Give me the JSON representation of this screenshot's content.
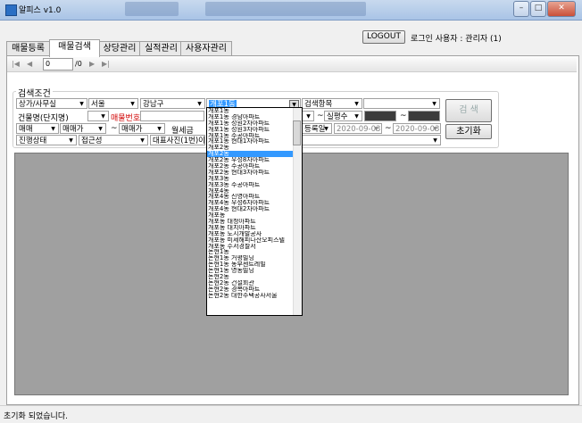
{
  "window": {
    "title": "알피스 v1.0"
  },
  "header": {
    "logout_label": "LOGOUT",
    "user_label": "로그인 사용자 : 관리자 (1)"
  },
  "tabs": [
    {
      "label": "매물등록"
    },
    {
      "label": "매물검색"
    },
    {
      "label": "상당관리"
    },
    {
      "label": "실적관리"
    },
    {
      "label": "사용자관리"
    }
  ],
  "toolbar": {
    "page_value": "0",
    "page_total": "/0"
  },
  "search": {
    "group_label": "검색조건",
    "row1": {
      "type": "상가/사무실",
      "city": "서울",
      "district": "강남구",
      "building": "개포1동",
      "item": "검색항목"
    },
    "row2": {
      "name_label": "건물명(단지명)",
      "number_label": "매물번호",
      "tilde": "~",
      "area": "실평수",
      "tilde2": "~"
    },
    "row3": {
      "deal": "매매",
      "price": "매매가",
      "tilde": "~",
      "price2": "매매가",
      "deposit": "월세금",
      "date_from": "2020-09-03",
      "date_to": "2020-09-03",
      "date_kind": "등록일"
    },
    "row4": {
      "status": "진행상태",
      "access": "접근성",
      "photo": "대표사진(1번)이름"
    },
    "search_button": "검 색",
    "reset_button": "초기화"
  },
  "dropdown": {
    "selected_index": 7,
    "items": [
      "개포1동",
      "개포1동 경남아파트",
      "개포1동 성원2차아파트",
      "개포1동 성원3차아파트",
      "개포1동 주공아파트",
      "개포1동 현대1차아파트",
      "개포2동",
      "개포2동",
      "개포2동 우성8차아파트",
      "개포2동 주공아파트",
      "개포2동 현대3차아파트",
      "개포3동",
      "개포3동 주공아파트",
      "개포4동",
      "개포4동 신영아파트",
      "개포4동 우성6차아파트",
      "개포4동 현대2차아파트",
      "개포동",
      "개포동 대청아파트",
      "개포동 대치아파트",
      "개포동 도시개발공사",
      "개포동 미세해피나산오피스텔",
      "개포동 수서경찰서",
      "논현1동",
      "논현1동 거평빌딩",
      "논현1동 동부센트레빌",
      "논현1동 영동빌딩",
      "논현2동",
      "논현2동 건설회관",
      "논현2동 경복아파트",
      "논현2동 대한주택공사서울"
    ]
  },
  "status": {
    "text": "초기화 되었습니다."
  }
}
